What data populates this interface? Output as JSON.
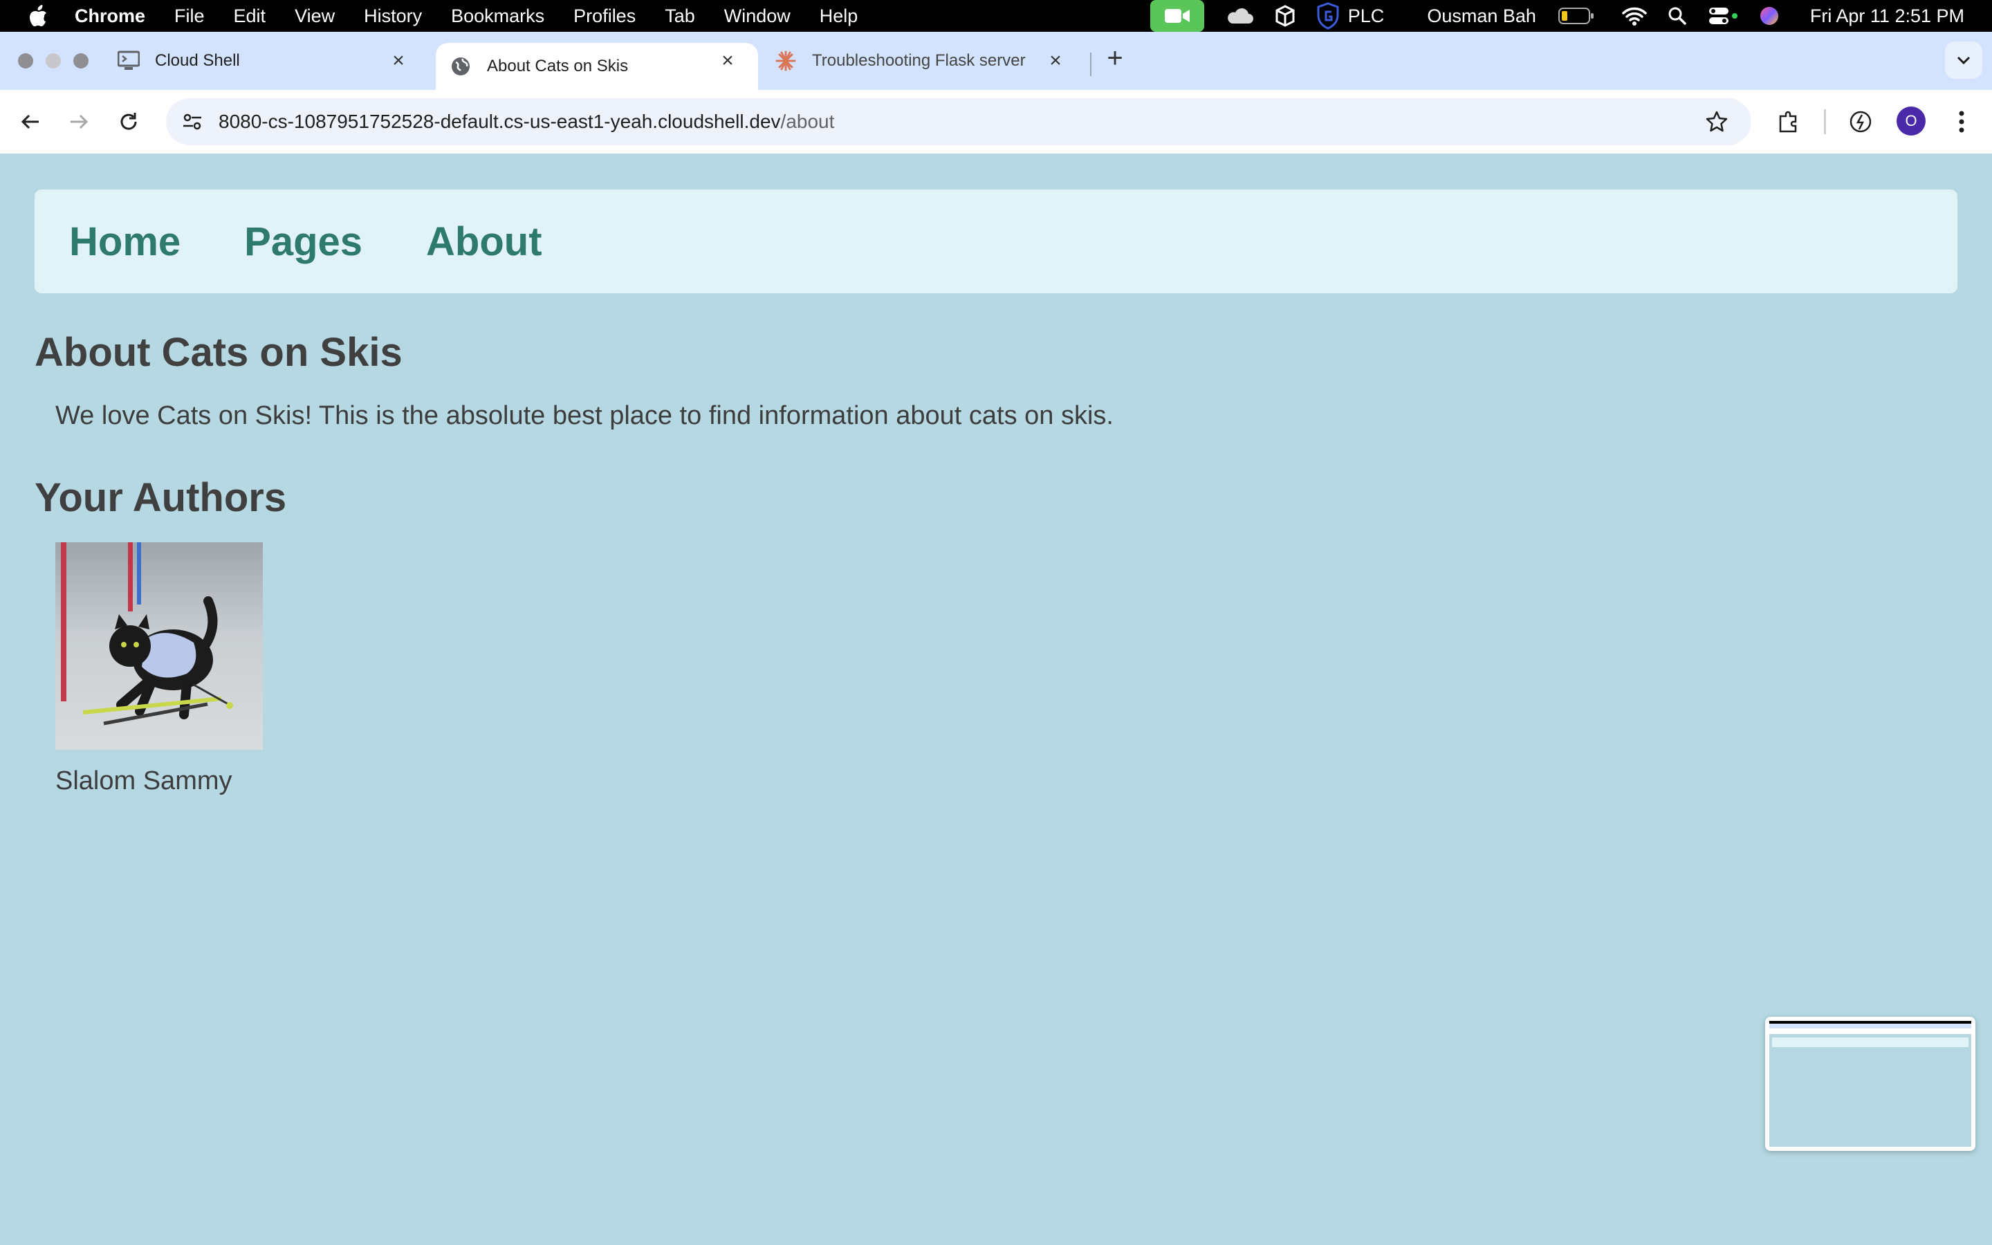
{
  "menubar": {
    "app_name": "Chrome",
    "items": [
      "File",
      "Edit",
      "View",
      "History",
      "Bookmarks",
      "Profiles",
      "Tab",
      "Window",
      "Help"
    ],
    "status_text": "PLC",
    "user_name": "Ousman Bah",
    "datetime": "Fri Apr 11  2:51 PM"
  },
  "tabs": [
    {
      "title": "Cloud Shell",
      "icon": "cloud-shell-icon"
    },
    {
      "title": "About Cats on Skis",
      "icon": "globe-icon"
    },
    {
      "title": "Troubleshooting Flask server",
      "icon": "claude-icon"
    }
  ],
  "toolbar": {
    "url_host": "8080-cs-1087951752528-default.cs-us-east1-yeah.cloudshell.dev",
    "url_path": "/about",
    "profile_initial": "O"
  },
  "nav": {
    "links": [
      "Home",
      "Pages",
      "About"
    ]
  },
  "content": {
    "heading": "About Cats on Skis",
    "intro": "We love Cats on Skis! This is the absolute best place to find information about cats on skis.",
    "authors_heading": "Your Authors",
    "authors": [
      {
        "name": "Slalom Sammy"
      }
    ]
  },
  "colors": {
    "page_bg": "#b5d8e3",
    "nav_bg": "#e2f3f8",
    "nav_link": "#2e7a6b",
    "heading": "#404040"
  }
}
